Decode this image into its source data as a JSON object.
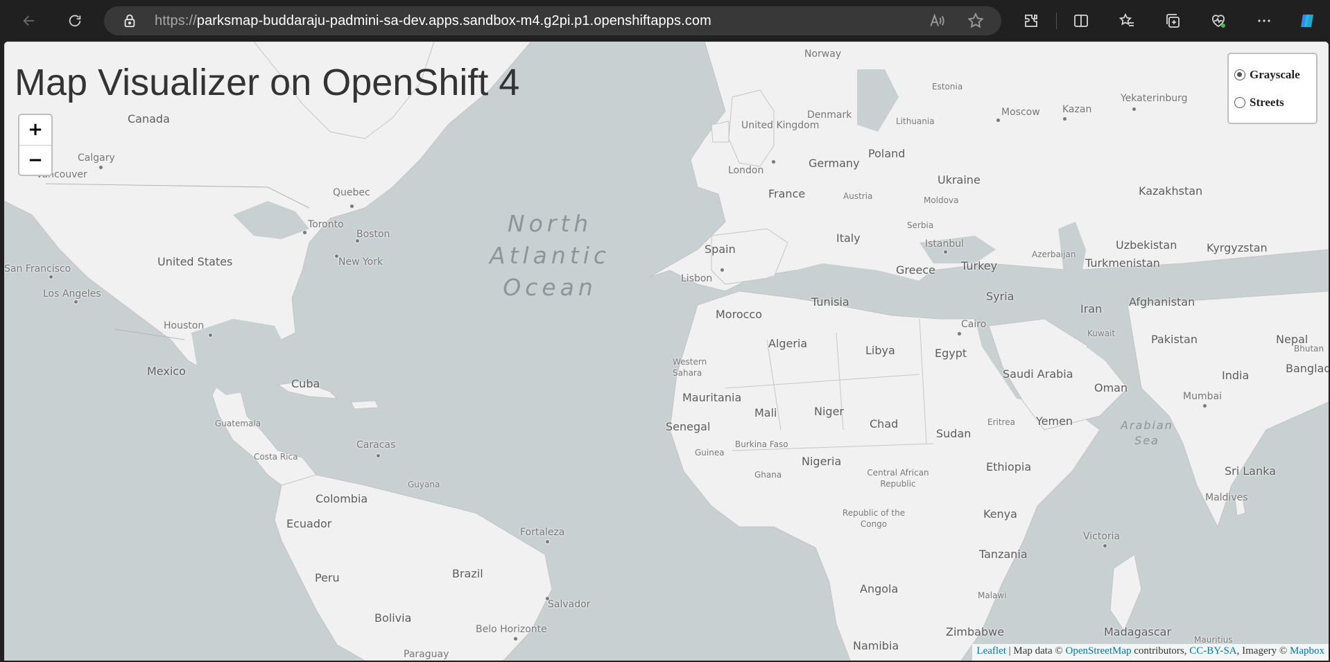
{
  "browser": {
    "url_scheme": "https://",
    "url_rest": "parksmap-buddaraju-padmini-sa-dev.apps.sandbox-m4.g2pi.p1.openshiftapps.com",
    "icons": [
      "back-icon",
      "refresh-icon",
      "lock-icon",
      "read-aloud-icon",
      "favorite-star-icon",
      "extensions-icon",
      "split-screen-icon",
      "favorites-icon",
      "collections-icon",
      "browser-essentials-icon",
      "more-icon",
      "copilot-icon"
    ]
  },
  "page": {
    "title": "Map Visualizer on OpenShift 4",
    "zoom_in": "+",
    "zoom_out": "−",
    "layers": [
      {
        "label": "Grayscale",
        "checked": true
      },
      {
        "label": "Streets",
        "checked": false
      }
    ],
    "attribution": {
      "leaflet": "Leaflet",
      "sep": " | Map data © ",
      "osm": "OpenStreetMap",
      "contrib": " contributors, ",
      "license": "CC-BY-SA",
      "imagery": ", Imagery © ",
      "mapbox": "Mapbox"
    }
  },
  "map_labels": {
    "ocean": [
      "North",
      "Atlantic",
      "Ocean"
    ],
    "arabian_sea": [
      "Arabian",
      "Sea"
    ],
    "countries": [
      "Canada",
      "United States",
      "Mexico",
      "Cuba",
      "Colombia",
      "Ecuador",
      "Peru",
      "Brazil",
      "Bolivia",
      "Guyana",
      "Spain",
      "France",
      "Germany",
      "United Kingdom",
      "Poland",
      "Ukraine",
      "Italy",
      "Greece",
      "Turkey",
      "Norway",
      "Denmark",
      "Estonia",
      "Lithuania",
      "Austria",
      "Serbia",
      "Moldova",
      "Kazakhstan",
      "Uzbekistan",
      "Kyrgyzstan",
      "Turkmenistan",
      "Azerbaijan",
      "Afghanistan",
      "Iran",
      "Pakistan",
      "India",
      "Nepal",
      "Bhutan",
      "Bangladesh",
      "Sri Lanka",
      "Maldives",
      "Syria",
      "Kuwait",
      "Saudi Arabia",
      "Oman",
      "Yemen",
      "Egypt",
      "Libya",
      "Tunisia",
      "Algeria",
      "Morocco",
      "Western Sahara",
      "Mauritania",
      "Mali",
      "Niger",
      "Chad",
      "Sudan",
      "Eritrea",
      "Ethiopia",
      "Senegal",
      "Guinea",
      "Burkina Faso",
      "Ghana",
      "Nigeria",
      "Central African Republic",
      "Republic of the Congo",
      "Kenya",
      "Tanzania",
      "Malawi",
      "Angola",
      "Zimbabwe",
      "Namibia",
      "Madagascar",
      "Mauritius",
      "Guatemala",
      "Costa Rica"
    ],
    "cities": [
      "Calgary",
      "Vancouver",
      "Quebec",
      "Toronto",
      "Boston",
      "New York",
      "San Francisco",
      "Los Angeles",
      "Houston",
      "Caracas",
      "Fortaleza",
      "Salvador",
      "Belo Horizonte",
      "Paraguay",
      "London",
      "Lisbon",
      "Istanbul",
      "Cairo",
      "Moscow",
      "Kazan",
      "Yekaterinburg",
      "Mumbai",
      "Victoria"
    ]
  }
}
